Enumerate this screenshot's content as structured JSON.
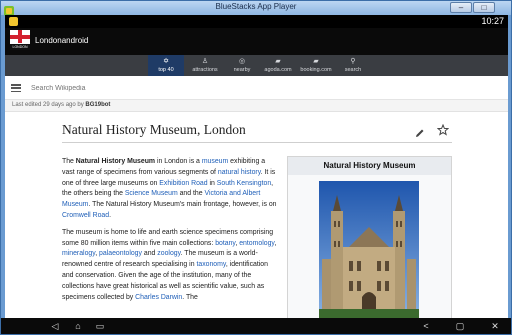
{
  "window": {
    "title": "BlueStacks App Player",
    "close_label": "X"
  },
  "status": {
    "time": "10:27"
  },
  "app": {
    "name": "Londonandroid",
    "flag_label": "LONDON"
  },
  "tabs": [
    {
      "label": "top 40",
      "icon": "star-icon",
      "glyph": "✡"
    },
    {
      "label": "attractions",
      "icon": "person-icon",
      "glyph": "♙"
    },
    {
      "label": "nearby",
      "icon": "location-icon",
      "glyph": "◎"
    },
    {
      "label": "agoda.com",
      "icon": "bed-icon",
      "glyph": "▰"
    },
    {
      "label": "booking.com",
      "icon": "bed-icon",
      "glyph": "▰"
    },
    {
      "label": "search",
      "icon": "search-icon",
      "glyph": "⚲"
    }
  ],
  "search": {
    "placeholder": "Search Wikipedia"
  },
  "edited": {
    "text": "Last edited 29 days ago by ",
    "user": "BG19bot"
  },
  "article": {
    "title": "Natural History Museum, London",
    "p1": [
      {
        "t": "The ",
        "type": "text"
      },
      {
        "t": "Natural History Museum",
        "type": "bold"
      },
      {
        "t": " in London is a ",
        "type": "text"
      },
      {
        "t": "museum",
        "type": "link"
      },
      {
        "t": " exhibiting a vast range of specimens from various segments of ",
        "type": "text"
      },
      {
        "t": "natural history",
        "type": "link"
      },
      {
        "t": ". It is one of three large museums on ",
        "type": "text"
      },
      {
        "t": "Exhibition Road",
        "type": "link"
      },
      {
        "t": " in ",
        "type": "text"
      },
      {
        "t": "South Kensington",
        "type": "link"
      },
      {
        "t": ", the others being the ",
        "type": "text"
      },
      {
        "t": "Science Museum",
        "type": "link"
      },
      {
        "t": " and the ",
        "type": "text"
      },
      {
        "t": "Victoria and Albert Museum",
        "type": "link"
      },
      {
        "t": ". The Natural History Museum's main frontage, however, is on ",
        "type": "text"
      },
      {
        "t": "Cromwell Road",
        "type": "link"
      },
      {
        "t": ".",
        "type": "text"
      }
    ],
    "p2": [
      {
        "t": "The museum is home to life and earth science specimens comprising some 80 million items within five main collections: ",
        "type": "text"
      },
      {
        "t": "botany",
        "type": "link"
      },
      {
        "t": ", ",
        "type": "text"
      },
      {
        "t": "entomology",
        "type": "link"
      },
      {
        "t": ", ",
        "type": "text"
      },
      {
        "t": "mineralogy",
        "type": "link"
      },
      {
        "t": ", ",
        "type": "text"
      },
      {
        "t": "palaeontology",
        "type": "link"
      },
      {
        "t": " and ",
        "type": "text"
      },
      {
        "t": "zoology",
        "type": "link"
      },
      {
        "t": ". The museum is a world-renowned centre of research specialising in ",
        "type": "text"
      },
      {
        "t": "taxonomy",
        "type": "link"
      },
      {
        "t": ", identification and conservation. Given the age of the institution, many of the collections have great historical as well as scientific value, such as specimens collected by ",
        "type": "text"
      },
      {
        "t": "Charles Darwin",
        "type": "link"
      },
      {
        "t": ". The",
        "type": "text"
      }
    ],
    "infobox_title": "Natural History Museum"
  },
  "nav": {
    "back": "◁",
    "home": "⌂",
    "recents": "▭",
    "share": "<",
    "screen": "▢",
    "close": "✕"
  }
}
